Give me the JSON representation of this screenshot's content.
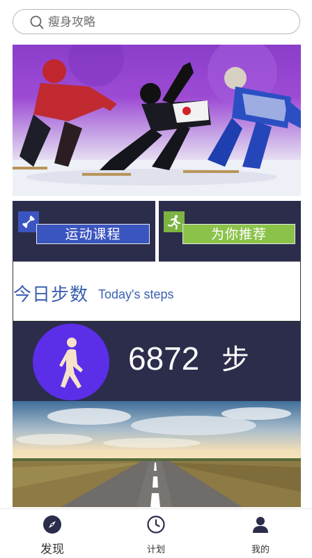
{
  "search": {
    "placeholder": "瘦身攻略"
  },
  "tiles": [
    {
      "label": "运动课程",
      "icon": "dumbbell-icon",
      "badge_color": "#3b55c0",
      "label_bg": "#3b55c0"
    },
    {
      "label": "为你推荐",
      "icon": "running-man-icon",
      "badge_color": "#7cb342",
      "label_bg": "#8bc34a"
    }
  ],
  "steps": {
    "title": "今日步数",
    "subtitle": "Today's steps",
    "count": "6872",
    "unit": "步",
    "icon": "walking-person-icon",
    "circle_color": "#5b2ee8"
  },
  "bottom_nav": [
    {
      "label": "发现",
      "icon": "compass-icon",
      "active": true
    },
    {
      "label": "计划",
      "icon": "clock-icon",
      "active": false
    },
    {
      "label": "我的",
      "icon": "person-icon",
      "active": false
    }
  ],
  "colors": {
    "panel": "#2c2d4b",
    "accent_text": "#3b5fb0"
  }
}
